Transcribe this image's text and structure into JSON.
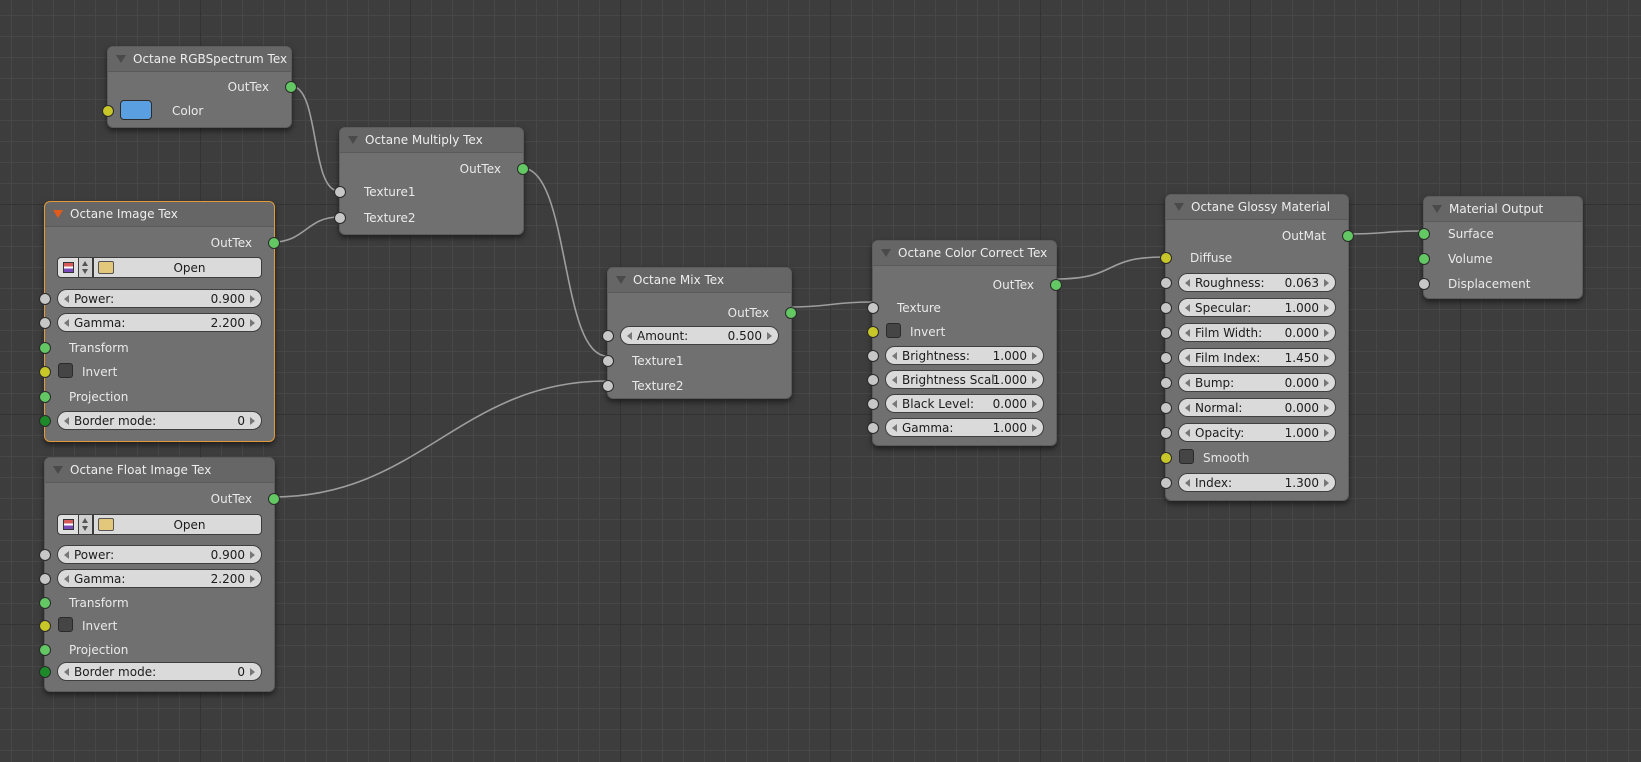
{
  "colors": {
    "background": "#3d3d3d",
    "node_body": "#707070",
    "active_outline": "#e29a39",
    "socket_texture": "#63c763",
    "socket_float": "#c7c7c7",
    "socket_bool": "#c7c729",
    "socket_enum": "#1d8a2a",
    "rgb_color": "#5a9fe0"
  },
  "nodes": {
    "rgb": {
      "title": "Octane RGBSpectrum Tex",
      "out": "OutTex",
      "color_label": "Color"
    },
    "multiply": {
      "title": "Octane Multiply Tex",
      "out": "OutTex",
      "in1": "Texture1",
      "in2": "Texture2"
    },
    "image": {
      "title": "Octane Image Tex",
      "out": "OutTex",
      "open": "Open",
      "power_label": "Power:",
      "power": "0.900",
      "gamma_label": "Gamma:",
      "gamma": "2.200",
      "transform": "Transform",
      "invert": "Invert",
      "projection": "Projection",
      "border_label": "Border mode:",
      "border": "0"
    },
    "float_image": {
      "title": "Octane Float Image Tex",
      "out": "OutTex",
      "open": "Open",
      "power_label": "Power:",
      "power": "0.900",
      "gamma_label": "Gamma:",
      "gamma": "2.200",
      "transform": "Transform",
      "invert": "Invert",
      "projection": "Projection",
      "border_label": "Border mode:",
      "border": "0"
    },
    "mix": {
      "title": "Octane Mix Tex",
      "out": "OutTex",
      "amount_label": "Amount:",
      "amount": "0.500",
      "in1": "Texture1",
      "in2": "Texture2"
    },
    "color_correct": {
      "title": "Octane Color Correct Tex",
      "out": "OutTex",
      "texture": "Texture",
      "invert": "Invert",
      "brightness_label": "Brightness:",
      "brightness": "1.000",
      "brightness_scale_label": "Brightness Scal:",
      "brightness_scale": "1.000",
      "black_level_label": "Black Level:",
      "black_level": "0.000",
      "gamma_label": "Gamma:",
      "gamma": "1.000"
    },
    "glossy": {
      "title": "Octane Glossy Material",
      "out": "OutMat",
      "diffuse": "Diffuse",
      "roughness_label": "Roughness:",
      "roughness": "0.063",
      "specular_label": "Specular:",
      "specular": "1.000",
      "film_width_label": "Film Width:",
      "film_width": "0.000",
      "film_index_label": "Film Index:",
      "film_index": "1.450",
      "bump_label": "Bump:",
      "bump": "0.000",
      "normal_label": "Normal:",
      "normal": "0.000",
      "opacity_label": "Opacity:",
      "opacity": "1.000",
      "smooth": "Smooth",
      "index_label": "Index:",
      "index": "1.300"
    },
    "output": {
      "title": "Material Output",
      "surface": "Surface",
      "volume": "Volume",
      "displacement": "Displacement"
    }
  }
}
